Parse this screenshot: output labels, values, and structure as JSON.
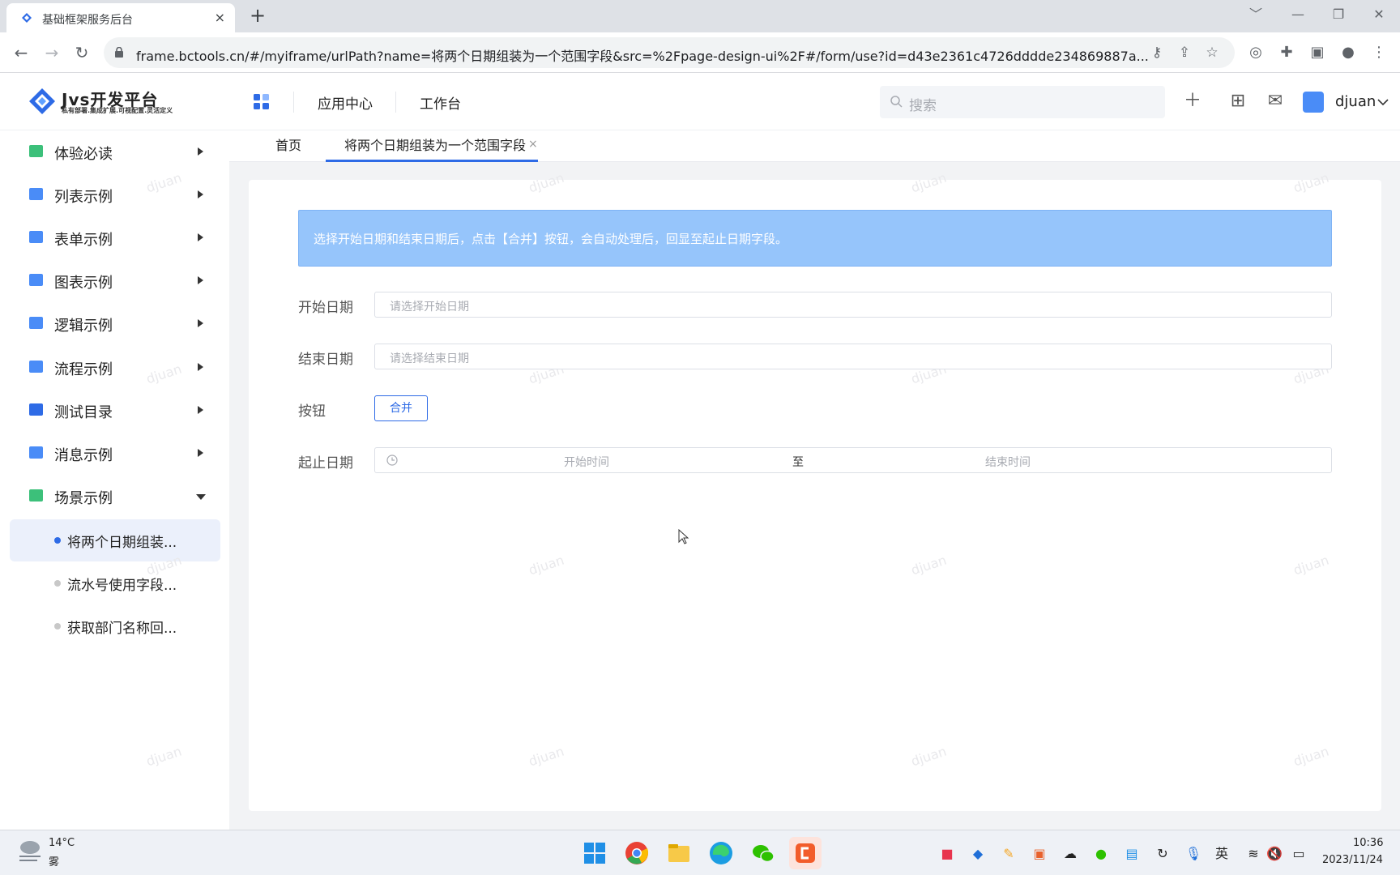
{
  "browser": {
    "tab_title": "基础框架服务后台",
    "tab_close": "×",
    "new_tab": "+",
    "url": "frame.bctools.cn/#/myiframe/urlPath?name=将两个日期组装为一个范围字段&src=%2Fpage-design-ui%2F#/form/use?id=d43e2361c4726dddde234869887a...",
    "window_controls": [
      "﹀",
      "—",
      "❐",
      "✕"
    ]
  },
  "app": {
    "brand": "Jvs开发平台",
    "slogan": "私有部署.集成扩展.可视配置.灵活定义",
    "nav": [
      "应用中心",
      "工作台"
    ],
    "search_placeholder": "搜索",
    "user": "djuan"
  },
  "sidebar": {
    "items": [
      {
        "label": "体验必读",
        "icon_color": "#3cc07a"
      },
      {
        "label": "列表示例",
        "icon_color": "#4a8cf7"
      },
      {
        "label": "表单示例",
        "icon_color": "#4a8cf7"
      },
      {
        "label": "图表示例",
        "icon_color": "#4a8cf7"
      },
      {
        "label": "逻辑示例",
        "icon_color": "#4a8cf7"
      },
      {
        "label": "流程示例",
        "icon_color": "#4a8cf7"
      },
      {
        "label": "测试目录",
        "icon_color": "#2e6be6"
      },
      {
        "label": "消息示例",
        "icon_color": "#4a8cf7"
      },
      {
        "label": "场景示例",
        "icon_color": "#3cc07a"
      }
    ],
    "sub_items": [
      {
        "label": "将两个日期组装...",
        "active": true
      },
      {
        "label": "流水号使用字段...",
        "active": false
      },
      {
        "label": "获取部门名称回...",
        "active": false
      }
    ]
  },
  "page_tabs": [
    {
      "label": "首页"
    },
    {
      "label": "将两个日期组装为一个范围字段",
      "close": "×"
    }
  ],
  "form": {
    "notice": "选择开始日期和结束日期后，点击【合并】按钮，会自动处理后，回显至起止日期字段。",
    "start_label": "开始日期",
    "start_placeholder": "请选择开始日期",
    "end_label": "结束日期",
    "end_placeholder": "请选择结束日期",
    "button_label": "按钮",
    "merge_button": "合并",
    "range_label": "起止日期",
    "range_start_placeholder": "开始时间",
    "range_separator": "至",
    "range_end_placeholder": "结束时间"
  },
  "watermark": "djuan",
  "taskbar": {
    "temperature": "14°C",
    "weather": "雾",
    "ime": "英",
    "time": "10:36",
    "date": "2023/11/24"
  },
  "colors": {
    "primary": "#2e6be6",
    "notice_bg": "#96c5fb",
    "active_bg": "#ebf0fb"
  }
}
